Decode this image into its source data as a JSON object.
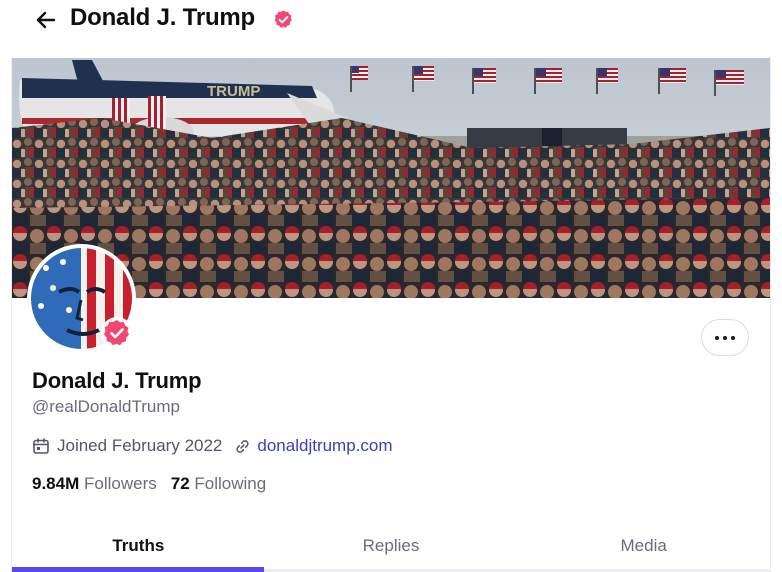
{
  "header": {
    "title": "Donald J. Trump",
    "back_icon": "arrow-left-icon",
    "verified_icon": "verified-badge-icon"
  },
  "banner": {
    "plane_text": "TRUMP"
  },
  "profile": {
    "display_name": "Donald J. Trump",
    "handle": "@realDonaldTrump",
    "joined": "Joined February 2022",
    "website": "donaldjtrump.com",
    "followers_count": "9.84M",
    "followers_label": "Followers",
    "following_count": "72",
    "following_label": "Following"
  },
  "tabs": [
    {
      "label": "Truths",
      "active": true
    },
    {
      "label": "Replies",
      "active": false
    },
    {
      "label": "Media",
      "active": false
    }
  ],
  "colors": {
    "accent": "#5448ee",
    "link": "#3c3fb8",
    "verified": "#f0486e"
  }
}
